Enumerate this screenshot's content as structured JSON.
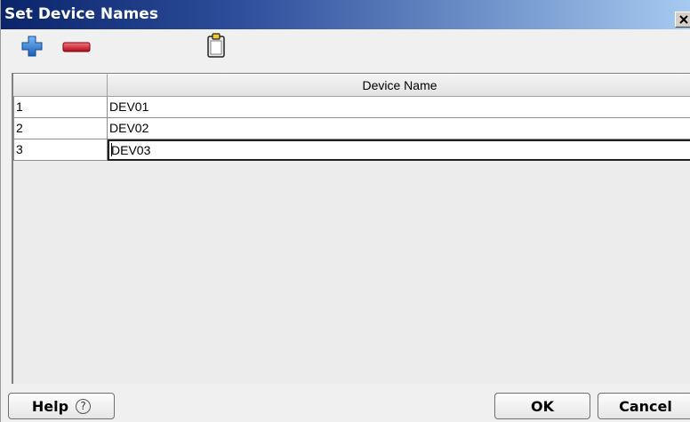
{
  "window": {
    "title": "Set Device Names",
    "close_icon": "close-icon"
  },
  "toolbar": {
    "add_icon": "plus-icon",
    "remove_icon": "minus-icon",
    "paste_icon": "clipboard-icon",
    "add_color": "#1b6fd0",
    "remove_color": "#c8102e"
  },
  "table": {
    "headers": [
      "",
      "Device Name"
    ],
    "rows": [
      {
        "index": "1",
        "name": "DEV01"
      },
      {
        "index": "2",
        "name": "DEV02"
      },
      {
        "index": "3",
        "name": "DEV03",
        "editing": true
      }
    ]
  },
  "footer": {
    "help_label": "Help",
    "help_icon": "question-icon",
    "ok_label": "OK",
    "cancel_label": "Cancel"
  }
}
